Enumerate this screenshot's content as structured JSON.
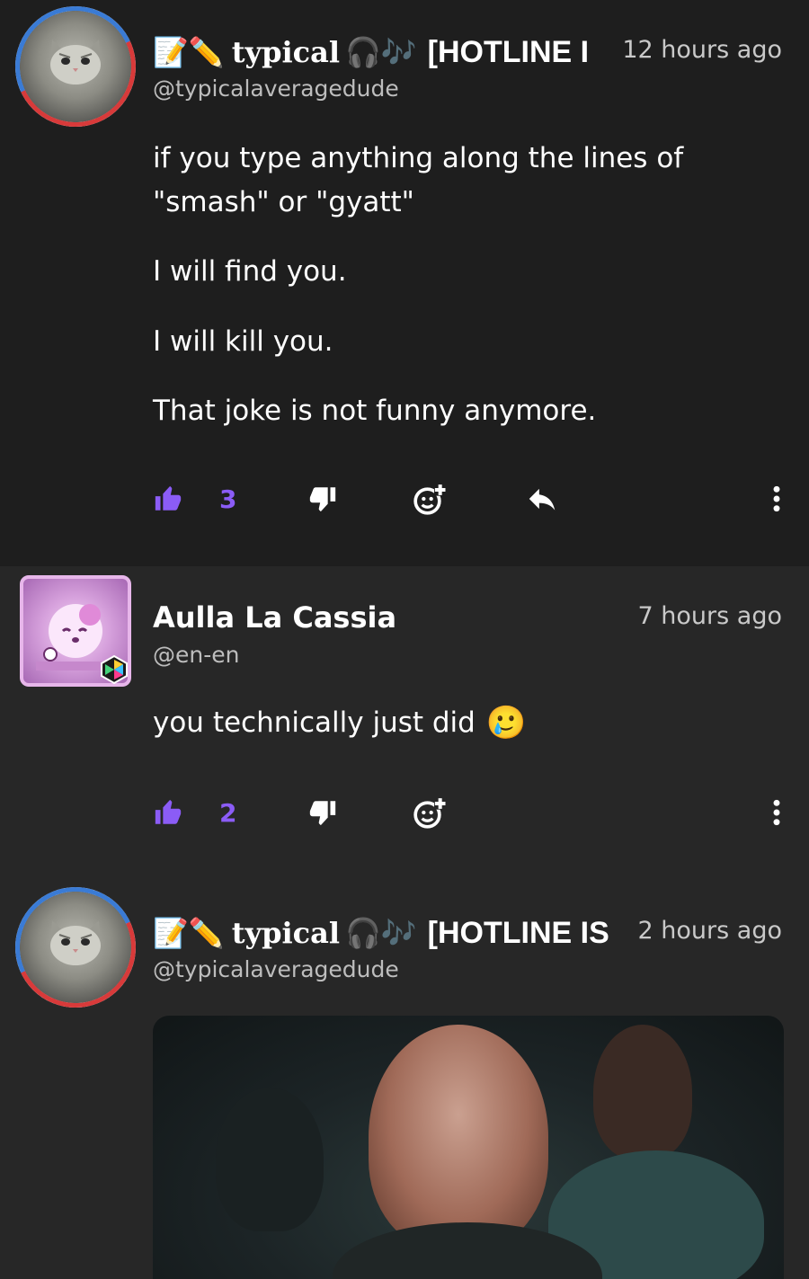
{
  "comments": [
    {
      "author": {
        "name_prefix_emoji": "📝✏️",
        "name": "typical",
        "name_suffix_emoji": "🎧🎶",
        "name_tail": "[HOTLINE I",
        "handle": "@typicalaveragedude"
      },
      "timestamp": "12 hours ago",
      "paragraphs": [
        "if you type anything along the lines of \"smash\" or \"gyatt\"",
        "I will find you.",
        "I will kill you.",
        "That joke is not funny anymore."
      ],
      "likes": "3"
    },
    {
      "author": {
        "name": "Aulla La Cassia",
        "handle": "@en-en"
      },
      "timestamp": "7 hours ago",
      "text": "you technically just did",
      "text_emoji": "🥲",
      "likes": "2"
    },
    {
      "author": {
        "name_prefix_emoji": "📝✏️",
        "name": "typical",
        "name_suffix_emoji": "🎧🎶",
        "name_tail": "[HOTLINE IS",
        "handle": "@typicalaveragedude"
      },
      "timestamp": "2 hours ago"
    }
  ],
  "icons": {
    "like": "thumbs-up-icon",
    "dislike": "thumbs-down-icon",
    "react": "add-reaction-icon",
    "reply": "reply-icon",
    "more": "more-vertical-icon"
  },
  "colors": {
    "accent": "#8b5cf6",
    "background_highlight": "#1e1e1e",
    "background": "#272727",
    "handle_text": "#bdbdbd"
  }
}
